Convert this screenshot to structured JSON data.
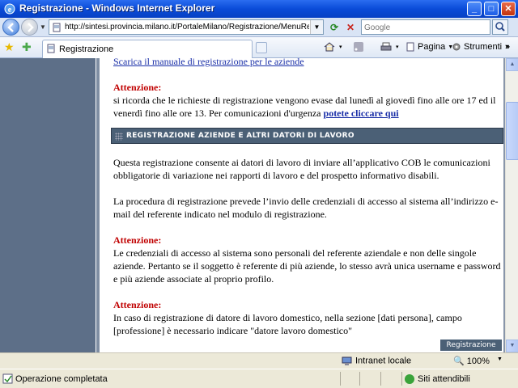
{
  "window": {
    "title": "Registrazione - Windows Internet Explorer",
    "min_glyph": "_",
    "max_glyph": "□",
    "close_glyph": "✕"
  },
  "address_bar": {
    "url": "http://sintesi.provincia.milano.it/PortaleMilano/Registrazione/MenuRegistrazioni",
    "search_placeholder": "Google"
  },
  "tab": {
    "label": "Registrazione"
  },
  "commands": {
    "home_dd": "▾",
    "print_dd": "▾",
    "page_label": "Pagina",
    "tools_label": "Strumenti",
    "help_glyph": "?",
    "more_glyph": "»"
  },
  "content": {
    "top_link": "Scarica il manuale di registrazione per le aziende",
    "attention_label": "Attenzione:",
    "notice_text": "si ricorda che le richieste di registrazione vengono evase dal lunedì al giovedì fino alle ore 17 ed il venerdì fino alle ore 13. Per comunicazioni d'urgenza",
    "notice_link": "potete cliccare qui",
    "section_title": "REGISTRAZIONE AZIENDE E ALTRI DATORI DI LAVORO",
    "para1": "Questa registrazione consente ai datori di lavoro di inviare all’applicativo COB le comunicazioni obbligatorie di variazione nei rapporti di lavoro e del prospetto informativo disabili.",
    "para2": "La procedura di registrazione prevede l’invio delle credenziali di accesso al sistema all’indirizzo e-mail del referente indicato nel modulo di registrazione.",
    "att2_label": "Attenzione:",
    "att2_text": "Le credenziali di accesso al sistema sono personali del referente aziendale e non delle singole aziende. Pertanto se il soggetto è referente di più aziende, lo stesso avrà unica username e password e più aziende associate al proprio profilo.",
    "att3_label": "Attenzione:",
    "att3_text": "In caso di registrazione di datore di lavoro domestico, nella sezione [dati persona], campo [professione] è necessario indicare \"datore lavoro domestico\"",
    "badge": "Registrazione"
  },
  "zone_bar": {
    "zone": "Intranet locale",
    "zoom": "100%"
  },
  "status_bar": {
    "status": "Operazione completata",
    "trusted": "Siti attendibili"
  },
  "colors": {
    "titlebar": "#0a4bd8",
    "left_band": "#5d6f88",
    "section_bar": "#4b6076",
    "attention": "#c00000",
    "link": "#1a2fa8"
  }
}
